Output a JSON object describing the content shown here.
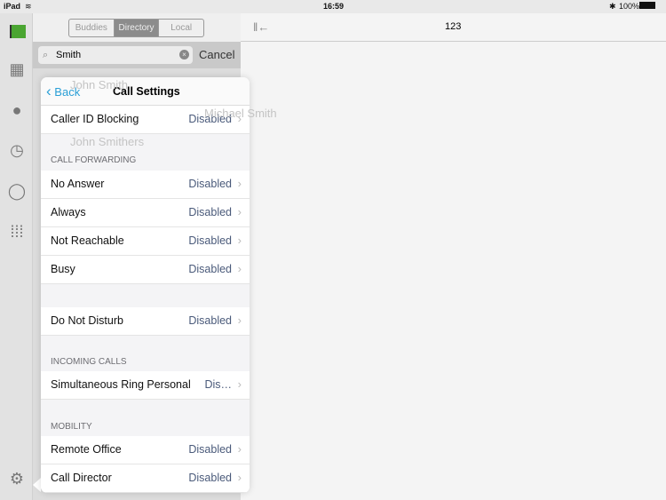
{
  "status": {
    "device": "iPad",
    "time": "16:59",
    "battery": "100%"
  },
  "sidebar": {
    "icons": [
      "flag-icon",
      "building-icon",
      "contact-icon",
      "history-icon",
      "chat-icon",
      "dialpad-icon",
      "gear-icon"
    ],
    "flag_color": "#4aa531"
  },
  "directory": {
    "tabs": [
      "Buddies",
      "Directory",
      "Local"
    ],
    "active_tab": "Directory",
    "search_value": "Smith",
    "cancel_label": "Cancel",
    "results": [
      "John Smith",
      "Michael Smith",
      "John Smithers"
    ]
  },
  "detail": {
    "title": "123"
  },
  "popover": {
    "back_label": "Back",
    "title": "Call Settings",
    "rows": {
      "caller_id": {
        "label": "Caller ID Blocking",
        "value": "Disabled"
      },
      "no_answer": {
        "label": "No Answer",
        "value": "Disabled"
      },
      "always": {
        "label": "Always",
        "value": "Disabled"
      },
      "not_reachable": {
        "label": "Not Reachable",
        "value": "Disabled"
      },
      "busy": {
        "label": "Busy",
        "value": "Disabled"
      },
      "dnd": {
        "label": "Do Not Disturb",
        "value": "Disabled"
      },
      "sim_ring": {
        "label": "Simultaneous Ring Personal",
        "value": "Dis…"
      },
      "remote_office": {
        "label": "Remote Office",
        "value": "Disabled"
      },
      "call_director": {
        "label": "Call Director",
        "value": "Disabled"
      }
    },
    "sections": {
      "forwarding": "CALL FORWARDING",
      "incoming": "INCOMING CALLS",
      "mobility": "MOBILITY"
    }
  }
}
